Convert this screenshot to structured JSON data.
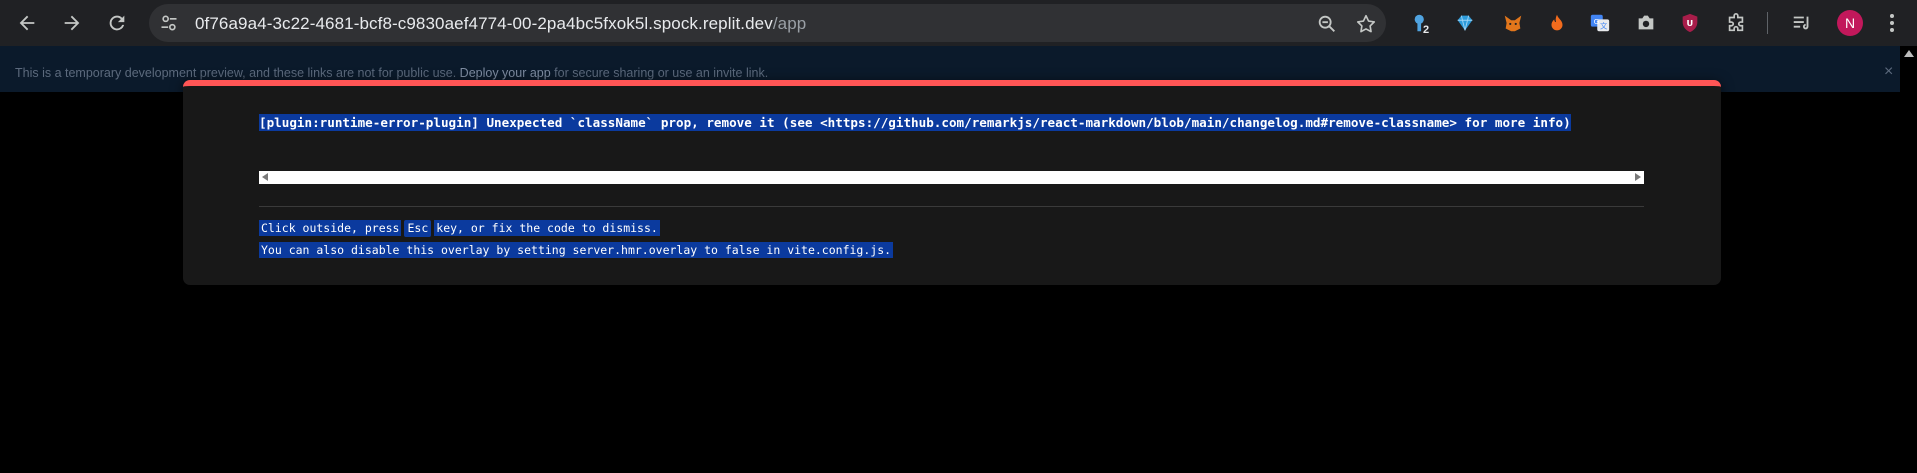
{
  "browser": {
    "url_host": "0f76a9a4-3c22-4681-bcf8-c9830aef4774-00-2pa4bc5fxok5l.spock.replit.dev",
    "url_path": "/app",
    "extension_badge": "2",
    "avatar_letter": "N",
    "icons": [
      "back-icon",
      "forward-icon",
      "reload-icon",
      "site-settings-icon",
      "zoom-icon",
      "bookmark-star-icon",
      "extensions-icon",
      "reading-list-icon",
      "menu-icon"
    ]
  },
  "banner": {
    "text_before": "This is a temporary development preview, and these links are not for public use. ",
    "link": "Deploy your app",
    "text_after": " for secure sharing or use an invite link.",
    "close": "×"
  },
  "overlay": {
    "message": "[plugin:runtime-error-plugin] Unexpected `className` prop, remove it (see <https://github.com/remarkjs/react-markdown/blob/main/changelog.md#remove-classname> for more info)",
    "tip_before_key": "Click outside, press",
    "tip_key": "Esc",
    "tip_after_key": "key, or fix the code to dismiss.",
    "tip2": "You can also disable this overlay by setting server.hmr.overlay to false in vite.config.js."
  },
  "colors": {
    "chrome_bg": "#202124",
    "omnibox_bg": "#303134",
    "overlay_bg": "#181818",
    "overlay_accent": "#ff5555",
    "selection_bg": "#0b3a9e",
    "avatar_bg": "#c2185b"
  }
}
